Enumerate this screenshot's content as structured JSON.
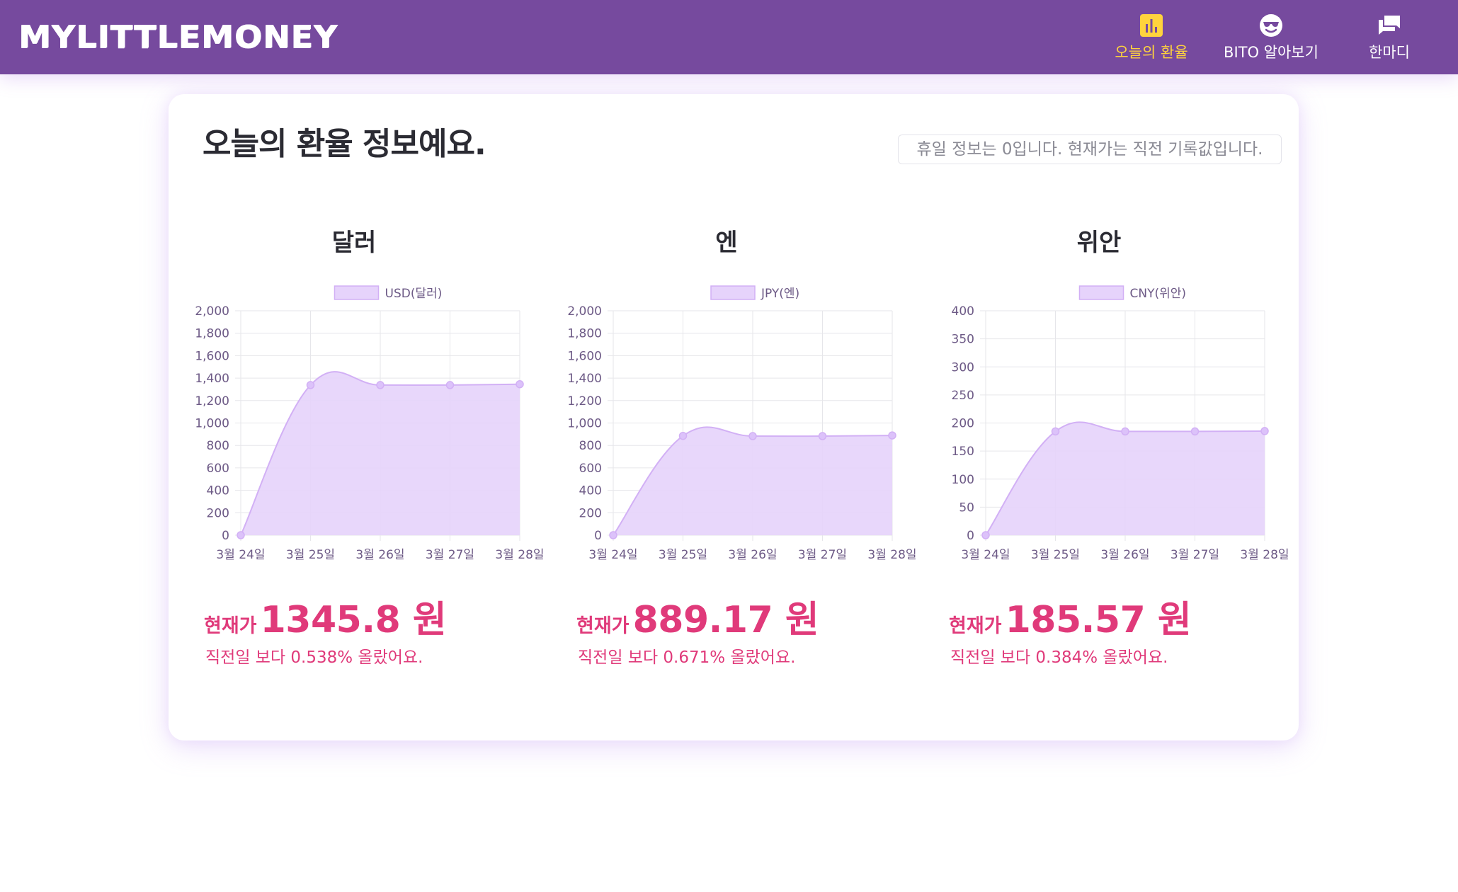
{
  "app": {
    "logo": "MYLITTLEMONEY"
  },
  "nav": {
    "items": [
      {
        "label": "오늘의 환율",
        "icon": "bar-chart-icon",
        "active": true
      },
      {
        "label": "BITO 알아보기",
        "icon": "sunglasses-smiley-icon",
        "active": false
      },
      {
        "label": "한마디",
        "icon": "chat-bubbles-icon",
        "active": false
      }
    ]
  },
  "main": {
    "title": "오늘의 환율 정보예요.",
    "notice": "휴일 정보는 0입니다. 현재가는 직전 기록값입니다."
  },
  "colors": {
    "header_bg": "#764a9e",
    "nav_active": "#ffd33d",
    "area_fill": "#e6d3fb",
    "area_line": "#d2b0f5",
    "accent_pink": "#e03a7a"
  },
  "currencies": [
    {
      "heading": "달러",
      "price_prefix": "현재가",
      "price": "1345.8 원",
      "change_text": "직전일 보다 0.538% 올랐어요."
    },
    {
      "heading": "엔",
      "price_prefix": "현재가",
      "price": "889.17 원",
      "change_text": "직전일 보다 0.671% 올랐어요."
    },
    {
      "heading": "위안",
      "price_prefix": "현재가",
      "price": "185.57 원",
      "change_text": "직전일 보다 0.384% 올랐어요."
    }
  ],
  "chart_data": [
    {
      "type": "area",
      "x": [
        "3월 24일",
        "3월 25일",
        "3월 26일",
        "3월 27일",
        "3월 28일"
      ],
      "series": [
        {
          "name": "USD(달러)",
          "values": [
            0,
            1338,
            1338,
            1338,
            1345.8
          ]
        }
      ],
      "ylim": [
        0,
        2000
      ],
      "yticks": [
        "0",
        "200",
        "400",
        "600",
        "800",
        "1,000",
        "1,200",
        "1,400",
        "1,600",
        "1,800",
        "2,000"
      ],
      "ytick_values": [
        0,
        200,
        400,
        600,
        800,
        1000,
        1200,
        1400,
        1600,
        1800,
        2000
      ],
      "grid": true,
      "legend": "top"
    },
    {
      "type": "area",
      "x": [
        "3월 24일",
        "3월 25일",
        "3월 26일",
        "3월 27일",
        "3월 28일"
      ],
      "series": [
        {
          "name": "JPY(엔)",
          "values": [
            0,
            885,
            883,
            883,
            889.17
          ]
        }
      ],
      "ylim": [
        0,
        2000
      ],
      "yticks": [
        "0",
        "200",
        "400",
        "600",
        "800",
        "1,000",
        "1,200",
        "1,400",
        "1,600",
        "1,800",
        "2,000"
      ],
      "ytick_values": [
        0,
        200,
        400,
        600,
        800,
        1000,
        1200,
        1400,
        1600,
        1800,
        2000
      ],
      "grid": true,
      "legend": "top"
    },
    {
      "type": "area",
      "x": [
        "3월 24일",
        "3월 25일",
        "3월 26일",
        "3월 27일",
        "3월 28일"
      ],
      "series": [
        {
          "name": "CNY(위안)",
          "values": [
            0,
            185,
            185,
            185,
            185.57
          ]
        }
      ],
      "ylim": [
        0,
        400
      ],
      "yticks": [
        "0",
        "50",
        "100",
        "150",
        "200",
        "250",
        "300",
        "350",
        "400"
      ],
      "ytick_values": [
        0,
        50,
        100,
        150,
        200,
        250,
        300,
        350,
        400
      ],
      "grid": true,
      "legend": "top"
    }
  ]
}
